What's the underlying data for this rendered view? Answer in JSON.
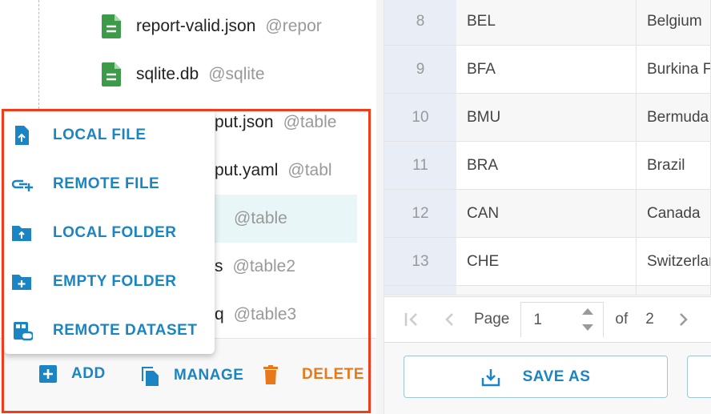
{
  "tree": {
    "items": [
      {
        "name": "report-valid.json",
        "alias": "@repor"
      },
      {
        "name": "sqlite.db",
        "alias": "@sqlite"
      },
      {
        "name": "put.json",
        "alias": "@table"
      },
      {
        "name": "put.yaml",
        "alias": "@tabl"
      },
      {
        "name": "",
        "alias": "@table",
        "selected": true
      },
      {
        "name": "s",
        "alias": "@table2"
      },
      {
        "name": "q",
        "alias": "@table3"
      }
    ]
  },
  "add_menu": {
    "items": [
      {
        "label": "LOCAL FILE",
        "icon": "file-upload-icon"
      },
      {
        "label": "REMOTE FILE",
        "icon": "link-add-icon"
      },
      {
        "label": "LOCAL FOLDER",
        "icon": "folder-upload-icon"
      },
      {
        "label": "EMPTY FOLDER",
        "icon": "folder-add-icon"
      },
      {
        "label": "REMOTE DATASET",
        "icon": "dataset-link-icon"
      }
    ]
  },
  "footer": {
    "add": "ADD",
    "manage": "MANAGE",
    "delete": "DELETE"
  },
  "table": {
    "rows": [
      {
        "idx": "8",
        "code": "BEL",
        "name": "Belgium"
      },
      {
        "idx": "9",
        "code": "BFA",
        "name": "Burkina Faso"
      },
      {
        "idx": "10",
        "code": "BMU",
        "name": "Bermuda"
      },
      {
        "idx": "11",
        "code": "BRA",
        "name": "Brazil"
      },
      {
        "idx": "12",
        "code": "CAN",
        "name": "Canada"
      },
      {
        "idx": "13",
        "code": "CHE",
        "name": "Switzerland"
      }
    ]
  },
  "pager": {
    "page_label": "Page",
    "page": "1",
    "of_label": "of",
    "total": "2"
  },
  "actions": {
    "save_as": "SAVE AS"
  },
  "colors": {
    "accent": "#1a85c2",
    "danger": "#e8791b",
    "file_icon": "#3d9a48",
    "highlight_box": "#f03c1a"
  }
}
